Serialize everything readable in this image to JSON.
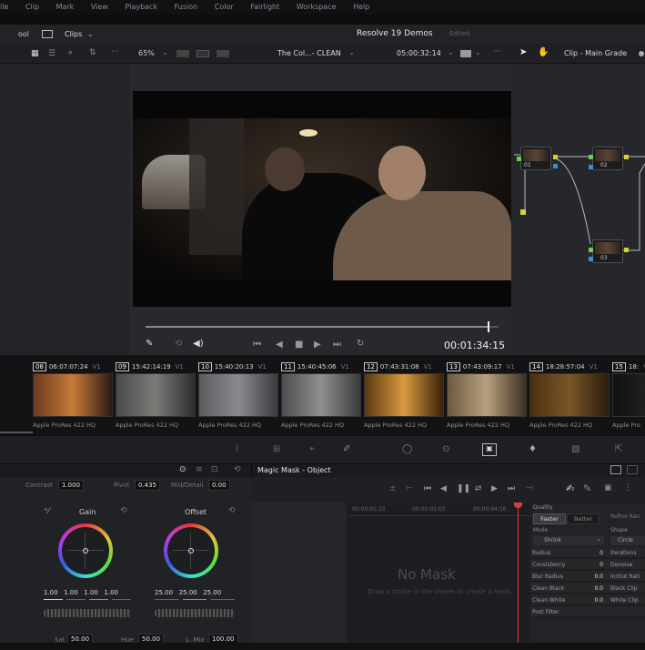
{
  "menu": {
    "items": [
      "ile",
      "Clip",
      "Mark",
      "View",
      "Playback",
      "Fusion",
      "Color",
      "Fairlight",
      "Workspace",
      "Help"
    ]
  },
  "topbar": {
    "left_label": "ool",
    "clips_label": "Clips",
    "project_title": "Resolve 19 Demos",
    "project_status": "Edited"
  },
  "toolbar": {
    "zoom": "65%",
    "timeline_name": "The Col...- CLEAN",
    "timecode": "05:00:32:14",
    "node_mode": "Clip - Main Grade"
  },
  "viewer": {
    "duration": "00:01:34:15",
    "scrub_position": 0.97
  },
  "clips": [
    {
      "num": "08",
      "tc": "06:07:07:24",
      "track": "V1",
      "codec": "Apple ProRes 422 HQ"
    },
    {
      "num": "09",
      "tc": "15:42:14:19",
      "track": "V1",
      "codec": "Apple ProRes 422 HQ"
    },
    {
      "num": "10",
      "tc": "15:40:20:13",
      "track": "V1",
      "codec": "Apple ProRes 422 HQ"
    },
    {
      "num": "11",
      "tc": "15:40:45:06",
      "track": "V1",
      "codec": "Apple ProRes 422 HQ"
    },
    {
      "num": "12",
      "tc": "07:43:31:08",
      "track": "V1",
      "codec": "Apple ProRes 422 HQ"
    },
    {
      "num": "13",
      "tc": "07:43:09:17",
      "track": "V1",
      "codec": "Apple ProRes 422 HQ"
    },
    {
      "num": "14",
      "tc": "18:28:57:04",
      "track": "V1",
      "codec": "Apple ProRes 422 HQ"
    },
    {
      "num": "15",
      "tc": "18:",
      "track": "V1",
      "codec": "Apple Pro"
    }
  ],
  "nodes": [
    {
      "label": "01"
    },
    {
      "label": "02"
    },
    {
      "label": "03"
    }
  ],
  "primaries": {
    "contrast_label": "Contrast",
    "contrast": "1.000",
    "pivot_label": "Pivot",
    "pivot": "0.435",
    "middetail_label": "Mid/Detail",
    "middetail": "0.00",
    "gain_label": "Gain",
    "offset_label": "Offset",
    "gain_values": [
      "1.00",
      "1.00",
      "1.00",
      "1.00"
    ],
    "offset_values": [
      "25.00",
      "25.00",
      "25.00"
    ],
    "sat_label": "Sat",
    "sat": "50.00",
    "hue_label": "Hue",
    "hue": "50.00",
    "lmix_label": "L. Mix",
    "lmix": "100.00"
  },
  "magic_mask": {
    "title": "Magic Mask - Object",
    "ruler": [
      "00:00:01:15",
      "00:00:02:03",
      "00:00:04:16"
    ],
    "empty_title": "No Mask",
    "empty_hint": "Draw a stroke in the viewer to create a mask."
  },
  "mask_settings": {
    "quality_label": "Quality",
    "faster": "Faster",
    "better": "Better",
    "refine_label": "Refine Ran",
    "mode_label": "Mode",
    "mode_value": "Shrink",
    "shape_label": "Shape",
    "shape_value": "Circle",
    "rows": [
      {
        "left": "Radius",
        "lval": "0",
        "right": "Iterations"
      },
      {
        "left": "Consistency",
        "lval": "0",
        "right": "Denoise"
      },
      {
        "left": "Blur Radius",
        "lval": "0.0",
        "right": "In/Out Rati"
      },
      {
        "left": "Clean Black",
        "lval": "0.0",
        "right": "Black Clip"
      },
      {
        "left": "Clean White",
        "lval": "0.0",
        "right": "White Clip"
      },
      {
        "left": "Post Filter",
        "lval": "",
        "right": ""
      }
    ]
  }
}
